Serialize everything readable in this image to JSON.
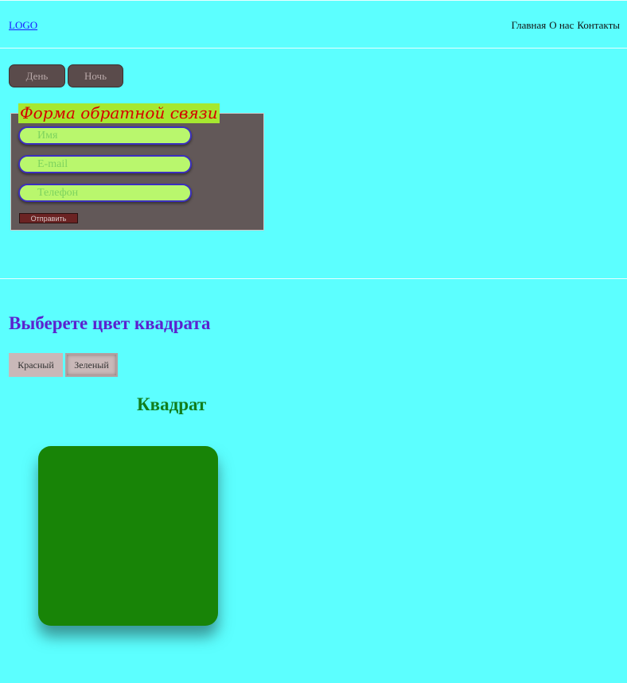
{
  "header": {
    "logo": "LOGO",
    "nav": [
      "Главная",
      "О нас",
      "Контакты"
    ]
  },
  "theme_buttons": {
    "day": "День",
    "night": "Ночь"
  },
  "form": {
    "title": "Форма обратной связи",
    "name_placeholder": "Имя",
    "email_placeholder": "E-mail",
    "phone_placeholder": "Телефон",
    "submit": "Отправить"
  },
  "color_picker": {
    "heading": "Выберете цвет квадрата",
    "red": "Красный",
    "green": "Зеленый",
    "selected": "Зеленый"
  },
  "square": {
    "title": "Квадрат",
    "color": "#188407"
  },
  "colors": {
    "background": "#5cffff",
    "form_title_bg": "#a6e830",
    "form_title_text": "#d40000",
    "heading_purple": "#5b22cf",
    "square_title_green": "#117e1d"
  }
}
